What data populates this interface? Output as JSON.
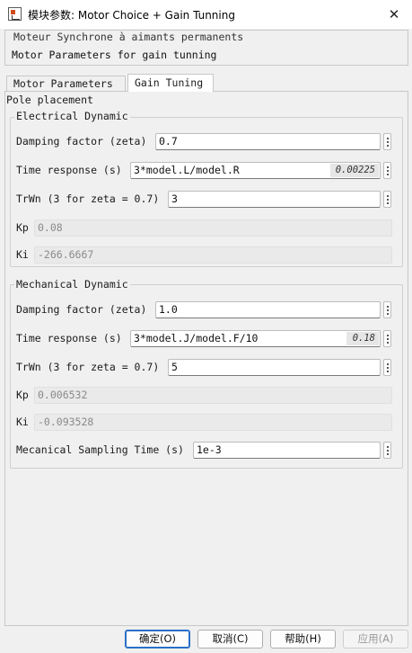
{
  "window": {
    "title": "模块参数: Motor Choice + Gain Tunning",
    "close_glyph": "✕"
  },
  "description": {
    "line1": "Moteur Synchrone à aimants permanents",
    "line2": "Motor Parameters for gain tunning"
  },
  "tabs": [
    {
      "label": "Motor Parameters",
      "active": false
    },
    {
      "label": "Gain Tuning",
      "active": true
    }
  ],
  "section_title": "Pole placement",
  "electrical": {
    "legend": "Electrical Dynamic",
    "damping_label": "Damping factor (zeta)",
    "damping_value": "0.7",
    "time_label": "Time response (s)",
    "time_value": "3*model.L/model.R",
    "time_eval": "0.00225",
    "trwn_label": "TrWn (3 for zeta = 0.7)",
    "trwn_value": "3",
    "kp_label": "Kp",
    "kp_value": "0.08",
    "ki_label": "Ki",
    "ki_value": "-266.6667"
  },
  "mechanical": {
    "legend": "Mechanical Dynamic",
    "damping_label": "Damping factor (zeta)",
    "damping_value": "1.0",
    "time_label": "Time response (s)",
    "time_value": "3*model.J/model.F/10",
    "time_eval": "0.18",
    "trwn_label": "TrWn (3 for zeta = 0.7)",
    "trwn_value": "5",
    "kp_label": "Kp",
    "kp_value": "0.006532",
    "ki_label": "Ki",
    "ki_value": "-0.093528",
    "sampling_label": "Mecanical Sampling Time (s)",
    "sampling_value": "1e-3"
  },
  "buttons": {
    "ok": "确定(O)",
    "cancel": "取消(C)",
    "help": "帮助(H)",
    "apply": "应用(A)"
  },
  "colors": {
    "primary_button_border": "#2a6fc9",
    "background": "#f0f0f0"
  }
}
